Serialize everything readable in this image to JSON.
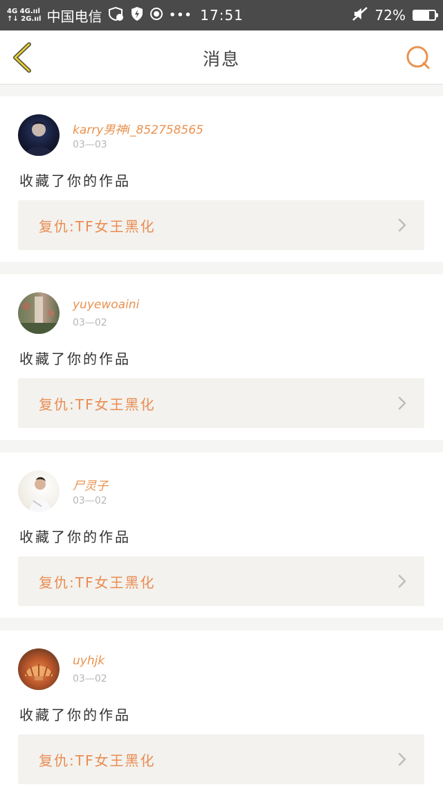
{
  "status_bar": {
    "net_top": "4G 4G.ııl",
    "net_bottom": "↑↓ 2G.ııl",
    "carrier": "中国电信",
    "time": "17:51",
    "battery_percent": "72%",
    "battery_level": 0.72
  },
  "header": {
    "title": "消息",
    "accent_color": "#e9924f"
  },
  "messages": [
    {
      "username": "karry男神i_852758565",
      "date": "03—03",
      "action": "收藏了你的作品",
      "work_title": "复仇:TF女王黑化"
    },
    {
      "username": "yuyewoaini",
      "date": "03—02",
      "action": "收藏了你的作品",
      "work_title": "复仇:TF女王黑化"
    },
    {
      "username": "尸灵子",
      "date": "03—02",
      "action": "收藏了你的作品",
      "work_title": "复仇:TF女王黑化"
    },
    {
      "username": "uyhjk",
      "date": "03—02",
      "action": "收藏了你的作品",
      "work_title": "复仇:TF女王黑化"
    }
  ]
}
